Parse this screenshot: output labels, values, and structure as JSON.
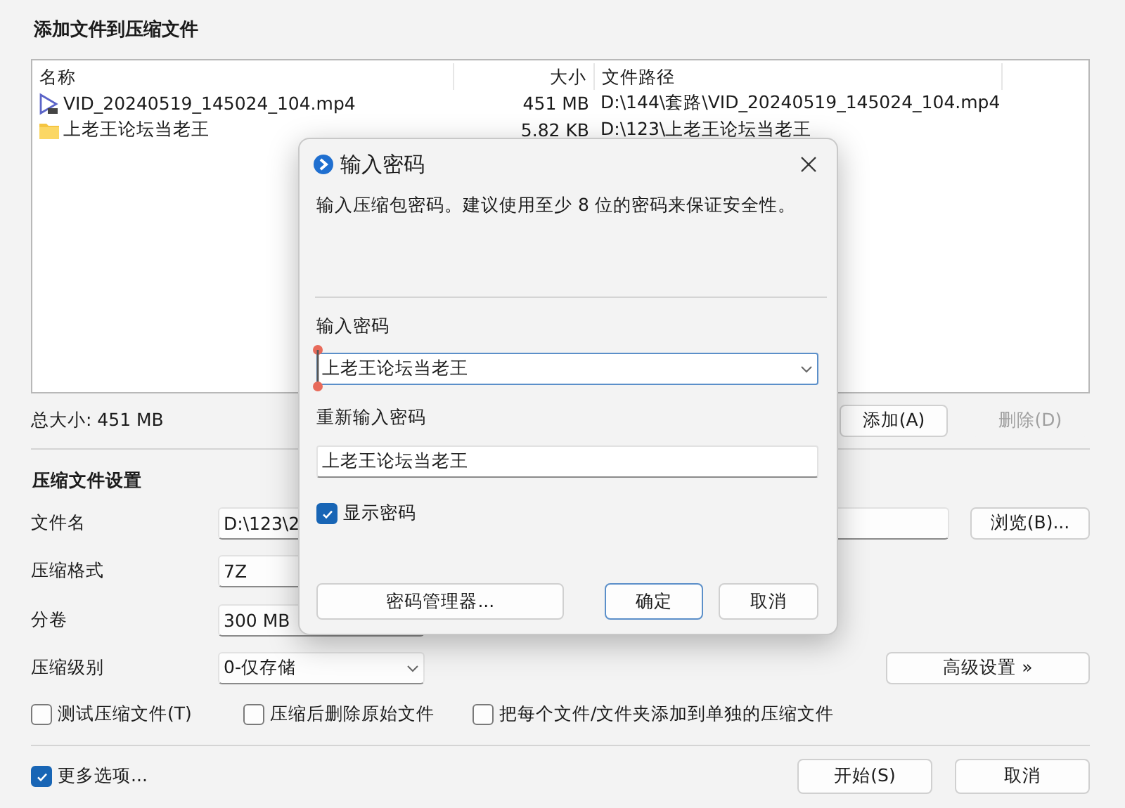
{
  "window": {
    "title": "添加文件到压缩文件"
  },
  "file_list": {
    "columns": [
      "名称",
      "大小",
      "文件路径"
    ],
    "rows": [
      {
        "kind": "video",
        "name": "VID_20240519_145024_104.mp4",
        "size": "451 MB",
        "path": "D:\\144\\套路\\VID_20240519_145024_104.mp4"
      },
      {
        "kind": "folder",
        "name": "上老王论坛当老王",
        "size": "5.82 KB",
        "path": "D:\\123\\上老王论坛当老王"
      }
    ]
  },
  "total_size": "总大小: 451 MB",
  "list_buttons": [
    {
      "label": "添加(A)",
      "disabled": false
    },
    {
      "label": "删除(D)",
      "disabled": true
    }
  ],
  "settings": {
    "title": "压缩文件设置",
    "fields": [
      {
        "label": "文件名",
        "kind": "text",
        "value": "D:\\123\\2",
        "button": "浏览(B)..."
      },
      {
        "label": "压缩格式",
        "kind": "box",
        "value": "7Z"
      },
      {
        "label": "分卷",
        "kind": "box",
        "value": "300 MB"
      },
      {
        "label": "压缩级别",
        "kind": "dropdown",
        "value": "0-仅存储",
        "button": "高级设置 »"
      }
    ],
    "options": [
      {
        "label": "测试压缩文件(T)",
        "checked": false
      },
      {
        "label": "压缩后删除原始文件",
        "checked": false
      },
      {
        "label": "把每个文件/文件夹添加到单独的压缩文件",
        "checked": false
      }
    ]
  },
  "more_options": {
    "label": "更多选项...",
    "checked": true
  },
  "buttons": [
    {
      "label": "开始(S)"
    },
    {
      "label": "取消"
    }
  ],
  "password_dialog": {
    "title": "输入密码",
    "description": "输入压缩包密码。建议使用至少 8 位的密码来保证安全性。",
    "password_label": "输入密码",
    "password": "上老王论坛当老王",
    "confirm_label": "重新输入密码",
    "confirm": "上老王论坛当老王",
    "show_password": {
      "label": "显示密码",
      "checked": true
    },
    "buttons": [
      {
        "label": "密码管理器...",
        "focused": false
      },
      {
        "label": "确定",
        "focused": true
      },
      {
        "label": "取消",
        "focused": false
      }
    ]
  }
}
